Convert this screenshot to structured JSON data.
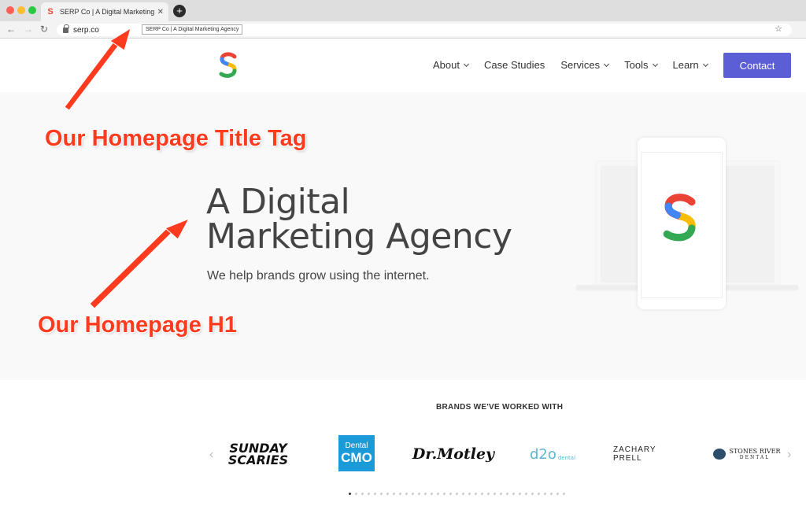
{
  "browser": {
    "tab_title": "SERP Co | A Digital Marketing A",
    "url": "serp.co",
    "tooltip": "SERP Co | A Digital Marketing Agency",
    "new_tab_icon": "plus-icon",
    "close_icon": "close-icon"
  },
  "header": {
    "logo_letter": "S",
    "nav": [
      {
        "label": "About",
        "has_dropdown": true
      },
      {
        "label": "Case Studies",
        "has_dropdown": false
      },
      {
        "label": "Services",
        "has_dropdown": true
      },
      {
        "label": "Tools",
        "has_dropdown": true
      },
      {
        "label": "Learn",
        "has_dropdown": true
      }
    ],
    "contact_label": "Contact",
    "accent_color": "#5b5ed4"
  },
  "hero": {
    "heading_line1": "A Digital",
    "heading_line2": "Marketing Agency",
    "subheading": "We help brands grow using the internet."
  },
  "annotations": {
    "title_tag": "Our Homepage Title Tag",
    "h1": "Our Homepage H1",
    "color": "#ff3b1f"
  },
  "brands": {
    "title": "BRANDS WE'VE WORKED WITH",
    "logos": [
      {
        "line1": "SUNDAY",
        "line2": "SCARIES"
      },
      {
        "line1": "Dental",
        "line2": "CMO"
      },
      {
        "text": "Dr.Motley"
      },
      {
        "text": "d2o",
        "sub": "dental"
      },
      {
        "text": "ZACHARY PRELL"
      },
      {
        "line1": "STONES RIVER",
        "line2": "DENTAL"
      }
    ],
    "dot_count": 35,
    "active_dot": 0
  }
}
